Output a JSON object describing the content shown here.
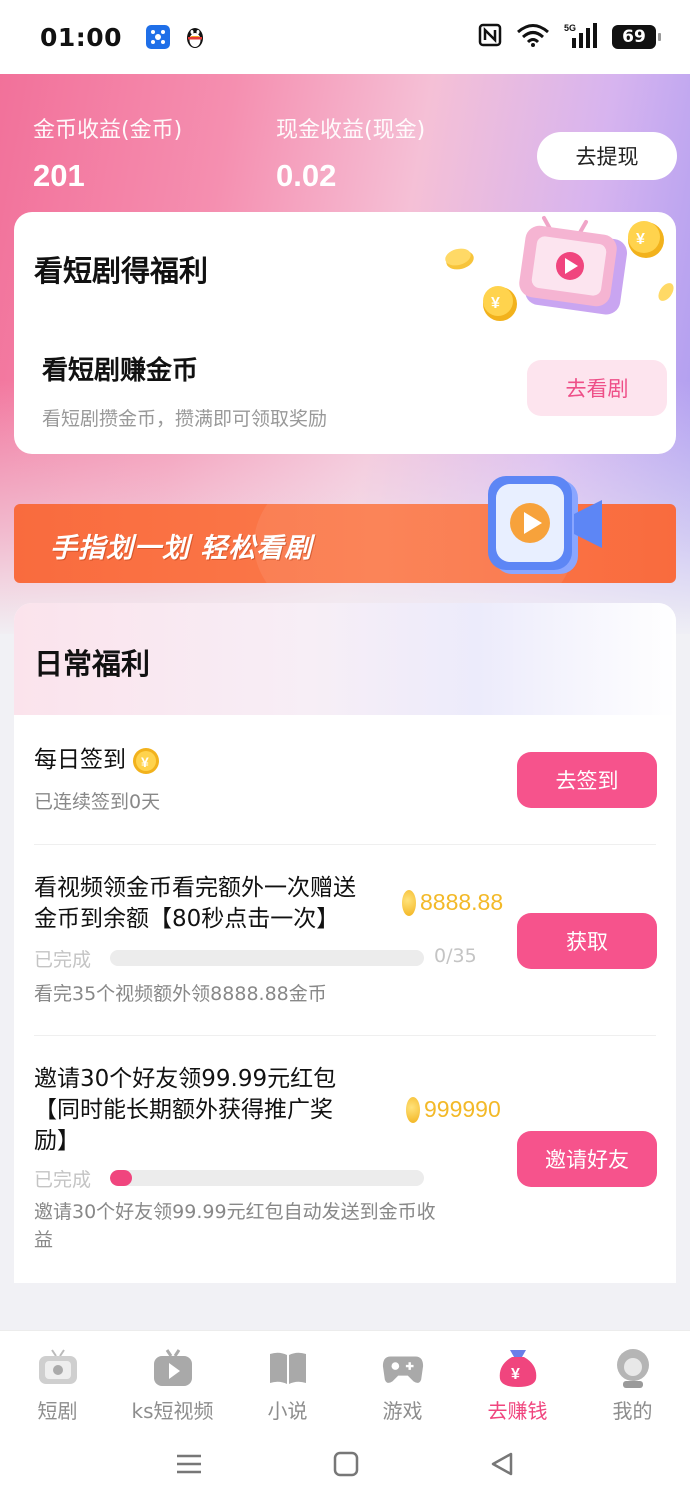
{
  "status_bar": {
    "time": "01:00",
    "battery": "69",
    "network": "5G"
  },
  "earnings": {
    "coin_label": "金币收益(金币)",
    "coin_value": "201",
    "cash_label": "现金收益(现金)",
    "cash_value": "0.02",
    "withdraw_label": "去提现"
  },
  "drama_card": {
    "title": "看短剧得福利",
    "subtitle": "看短剧赚金币",
    "description": "看短剧攒金币，攒满即可领取奖励",
    "button_label": "去看剧"
  },
  "banner": {
    "text": "手指划一划 轻松看剧"
  },
  "daily": {
    "title": "日常福利",
    "tasks": [
      {
        "title": "每日签到",
        "subtitle": "已连续签到0天",
        "button_label": "去签到"
      },
      {
        "title_line1": "看视频领金币看完额外一次赠送",
        "title_line2": "金币到余额【80秒点击一次】",
        "reward": "8888.88",
        "done_label": "已完成",
        "progress_text": "0/35",
        "progress": 0,
        "subtitle": "看完35个视频额外领8888.88金币",
        "button_label": "获取"
      },
      {
        "title_line1": "邀请30个好友领99.99元红包",
        "title_line2": "【同时能长期额外获得推广奖",
        "title_line3": "励】",
        "reward": "999990",
        "done_label": "已完成",
        "progress": 0.07,
        "subtitle_line1": "邀请30个好友领99.99元红包自动发送到金币收",
        "subtitle_line2": "益",
        "button_label": "邀请好友"
      }
    ]
  },
  "bottom_nav": {
    "items": [
      {
        "label": "短剧",
        "icon": "tv-icon"
      },
      {
        "label": "ks短视频",
        "icon": "video-play-icon"
      },
      {
        "label": "小说",
        "icon": "book-icon"
      },
      {
        "label": "游戏",
        "icon": "gamepad-icon"
      },
      {
        "label": "去赚钱",
        "icon": "money-bag-icon"
      },
      {
        "label": "我的",
        "icon": "profile-icon"
      }
    ],
    "active_index": 4
  },
  "colors": {
    "accent": "#f6538c",
    "coin": "#f3b928",
    "banner": "#f96b3e"
  }
}
